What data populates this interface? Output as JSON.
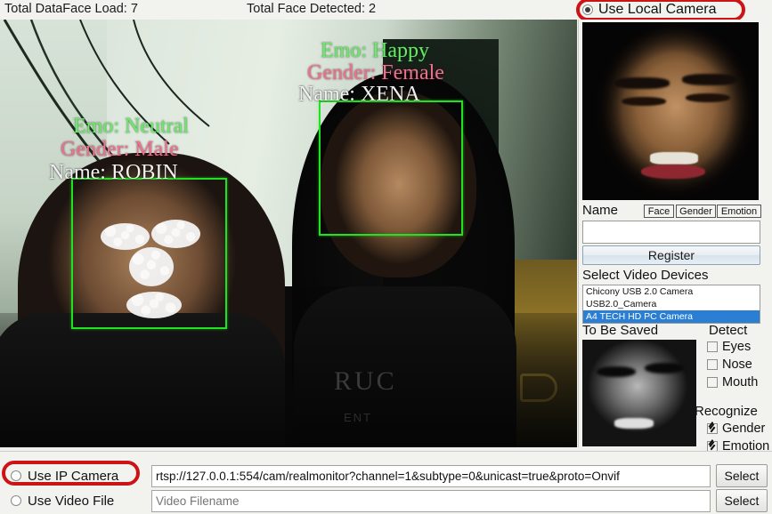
{
  "topbar": {
    "load_label": "Total DataFace Load: 7",
    "detected_label": "Total Face Detected: 2"
  },
  "source": {
    "local_camera_label": "Use Local Camera",
    "local_camera_selected": true,
    "ip_camera_label": "Use IP Camera",
    "ip_camera_selected": false,
    "video_file_label": "Use Video File",
    "video_file_selected": false,
    "ip_url_value": "rtsp://127.0.0.1:554/cam/realmonitor?channel=1&subtype=0&unicast=true&proto=Onvif",
    "video_file_placeholder": "Video Filename",
    "video_file_value": "",
    "select_ip_label": "Select",
    "select_file_label": "Select",
    "highlight_color": "#cc1417"
  },
  "video": {
    "faces": [
      {
        "name_text": "Name: ROBIN",
        "emotion_text": "Emo: Neutral",
        "gender_text": "Gender: Male"
      },
      {
        "name_text": "Name: XENA",
        "emotion_text": "Emo: Happy",
        "gender_text": "Gender: Female"
      }
    ],
    "box_color": "#22e022",
    "emotion_color": "#6ce86c",
    "gender_color": "#e8748c",
    "name_color": "#f2f2f2",
    "shirt_text": "RUC",
    "shirt_subtext": "ENT"
  },
  "panel": {
    "name_label": "Name",
    "name_value": "",
    "name_placeholder": "",
    "mini_buttons": {
      "face": "Face",
      "gender": "Gender",
      "emotion": "Emotion"
    },
    "register_label": "Register",
    "devices_label": "Select Video Devices",
    "devices": [
      {
        "label": "Chicony USB 2.0 Camera",
        "selected": false
      },
      {
        "label": "USB2.0_Camera",
        "selected": false
      },
      {
        "label": "A4 TECH HD PC Camera",
        "selected": true
      }
    ],
    "selection_color": "#2a7fd4",
    "saved_label": "To Be Saved",
    "detect_title": "Detect",
    "detect": [
      {
        "label": "Eyes",
        "checked": false
      },
      {
        "label": "Nose",
        "checked": false
      },
      {
        "label": "Mouth",
        "checked": false
      }
    ],
    "recognize_title": "Recognize",
    "recognize": [
      {
        "label": "Gender",
        "checked": true
      },
      {
        "label": "Emotion",
        "checked": true
      }
    ]
  }
}
